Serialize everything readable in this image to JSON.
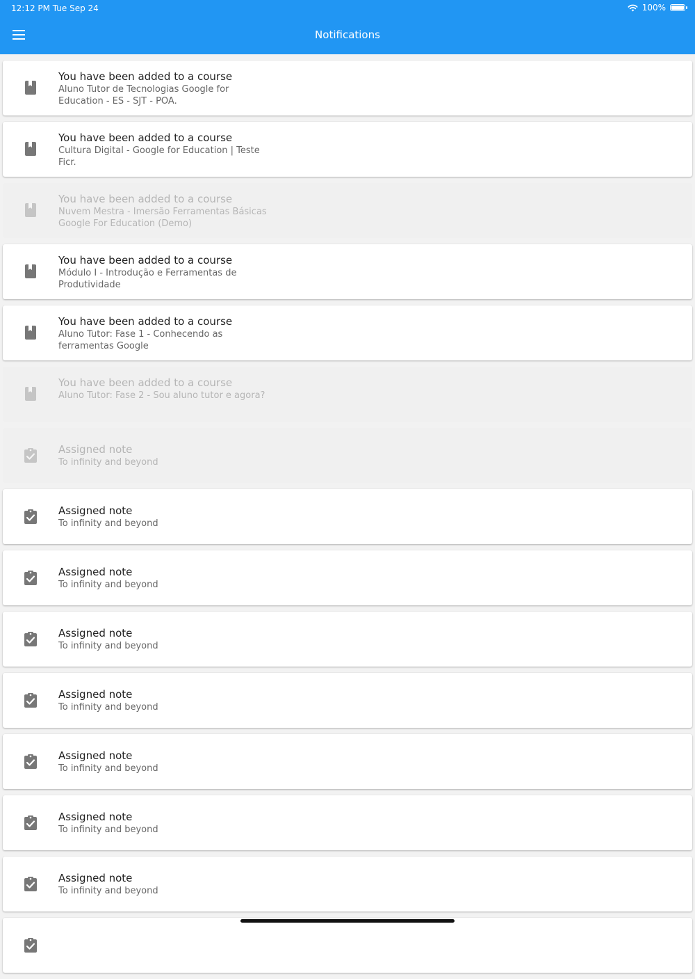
{
  "statusbar": {
    "time": "12:12 PM   Tue Sep 24",
    "battery_text": "100%",
    "battery_level": 1.0,
    "icons": [
      "wifi-icon",
      "battery-icon"
    ]
  },
  "appbar": {
    "title": "Notifications",
    "menu_icon": "hamburger-menu-icon",
    "color": "#2196f3"
  },
  "notifications": [
    {
      "title": "You have been added to a course",
      "subtitle": "Aluno Tutor de Tecnologias Google for Education - ES - SJT - POA.",
      "icon": "book-icon",
      "read": false
    },
    {
      "title": "You have been added to a course",
      "subtitle": "Cultura Digital - Google for Education | Teste Ficr.",
      "icon": "book-icon",
      "read": false
    },
    {
      "title": "You have been added to a course",
      "subtitle": "Nuvem Mestra - Imersão Ferramentas Básicas Google For Education (Demo)",
      "icon": "book-icon",
      "read": true
    },
    {
      "title": "You have been added to a course",
      "subtitle": "Módulo I - Introdução e Ferramentas de Produtividade",
      "icon": "book-icon",
      "read": false
    },
    {
      "title": "You have been added to a course",
      "subtitle": "Aluno Tutor: Fase 1 - Conhecendo as ferramentas Google",
      "icon": "book-icon",
      "read": false
    },
    {
      "title": "You have been added to a course",
      "subtitle": "Aluno Tutor: Fase 2 - Sou aluno tutor e agora?",
      "icon": "book-icon",
      "read": true
    },
    {
      "title": "Assigned note",
      "subtitle": "To infinity and beyond",
      "icon": "assignment-check-icon",
      "read": true
    },
    {
      "title": "Assigned note",
      "subtitle": "To infinity and beyond",
      "icon": "assignment-check-icon",
      "read": false
    },
    {
      "title": "Assigned note",
      "subtitle": "To infinity and beyond",
      "icon": "assignment-check-icon",
      "read": false
    },
    {
      "title": "Assigned note",
      "subtitle": "To infinity and beyond",
      "icon": "assignment-check-icon",
      "read": false
    },
    {
      "title": "Assigned note",
      "subtitle": "To infinity and beyond",
      "icon": "assignment-check-icon",
      "read": false
    },
    {
      "title": "Assigned note",
      "subtitle": "To infinity and beyond",
      "icon": "assignment-check-icon",
      "read": false
    },
    {
      "title": "Assigned note",
      "subtitle": "To infinity and beyond",
      "icon": "assignment-check-icon",
      "read": false
    },
    {
      "title": "Assigned note",
      "subtitle": "To infinity and beyond",
      "icon": "assignment-check-icon",
      "read": false
    },
    {
      "title": "",
      "subtitle": "",
      "icon": "assignment-check-icon",
      "read": false
    }
  ]
}
